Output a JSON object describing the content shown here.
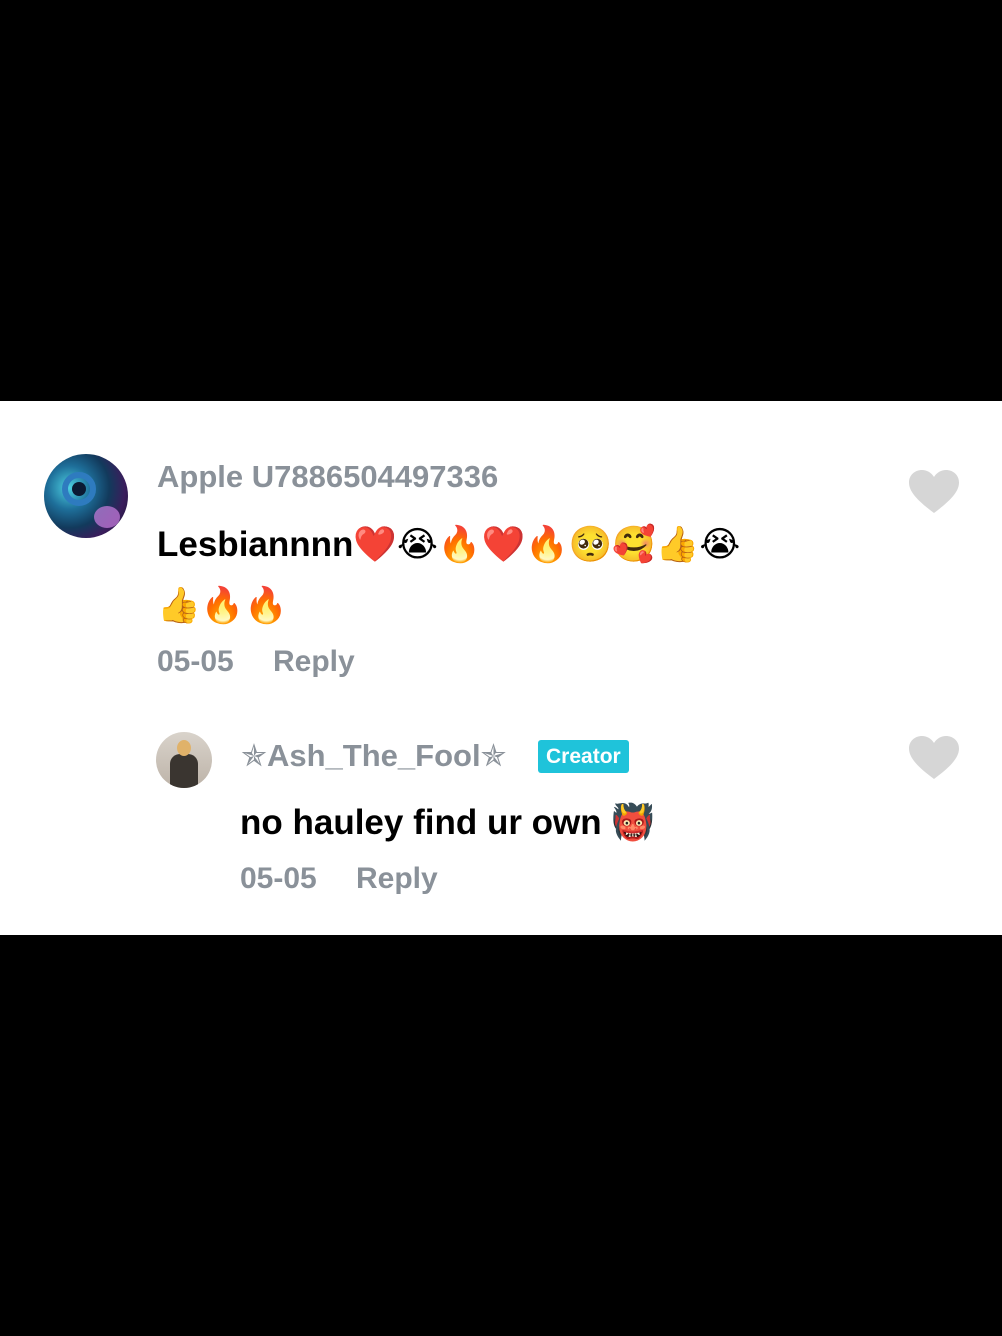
{
  "comments": [
    {
      "username": "Apple U7886504497336",
      "text_line1": "Lesbiannnn❤️😭🔥❤️🔥🥺🥰👍😭",
      "text_line2": "👍🔥🔥",
      "date": "05-05",
      "reply_label": "Reply",
      "avatar_icon": "avatar-image",
      "like_icon": "heart-icon"
    }
  ],
  "replies": [
    {
      "username": "✯Ash_The_Fool✯",
      "badge": "Creator",
      "text": "no hauley find ur own 👹",
      "date": "05-05",
      "reply_label": "Reply",
      "avatar_icon": "avatar-image",
      "like_icon": "heart-icon"
    }
  ],
  "colors": {
    "background_bars": "#000000",
    "panel": "#ffffff",
    "username": "#8a9199",
    "text": "#000000",
    "badge": "#1fc3da",
    "heart": "#d6d6d6"
  }
}
